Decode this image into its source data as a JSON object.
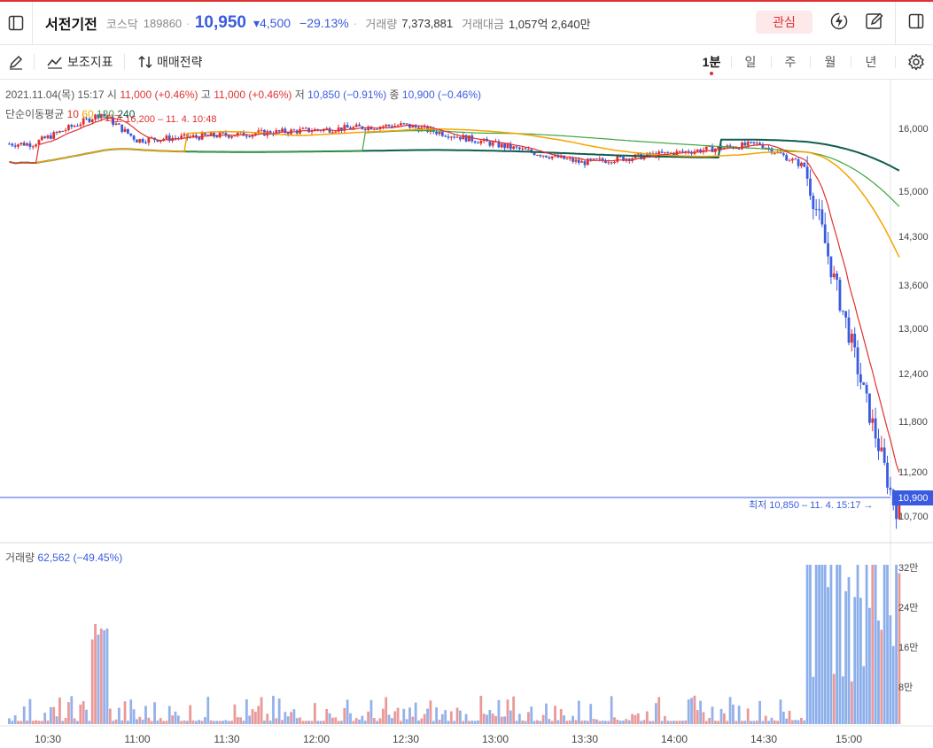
{
  "header": {
    "name": "서전기전",
    "market": "코스닥",
    "code": "189860",
    "price": "10,950",
    "change": "▾4,500",
    "change_pct": "−29.13%",
    "volume_label": "거래량",
    "volume_value": "7,373,881",
    "amount_label": "거래대금",
    "amount_value": "1,057억 2,640만",
    "fav_label": "관심"
  },
  "toolbar": {
    "indicator_label": "보조지표",
    "strategy_label": "매매전략",
    "periods": [
      "1분",
      "일",
      "주",
      "월",
      "년"
    ],
    "active_period": "1분"
  },
  "info": {
    "date": "2021.11.04(목) 15:17",
    "open_label": "시",
    "open": "11,000 (+0.46%)",
    "high_label": "고",
    "high": "11,000 (+0.46%)",
    "low_label": "저",
    "low": "10,850 (−0.91%)",
    "close_label": "종",
    "close": "10,900 (−0.46%)",
    "ma_label": "단순이동평균",
    "ma": [
      "10",
      "60",
      "120",
      "240"
    ],
    "max_note": "최고 16,200 – 11. 4. 10:48",
    "min_note": "최저 10,850 – 11. 4. 15:17 →",
    "volume_label": "거래량",
    "volume_value": "62,562 (−49.45%)"
  },
  "colors": {
    "up": "#e03131",
    "down": "#3a5be0",
    "ma10": "#e03131",
    "ma60": "#f5a300",
    "ma120": "#3da53d",
    "ma240": "#0e5e4e"
  },
  "icons": [
    "panel-icon",
    "flash-icon",
    "edit-icon",
    "panel-icon",
    "pencil-icon",
    "indicator-icon",
    "strategy-icon",
    "gear-icon"
  ],
  "chart_data": {
    "type": "candlestick",
    "current_price": "10,900",
    "price_ticks": [
      "16,000",
      "15,000",
      "14,300",
      "13,600",
      "13,000",
      "12,400",
      "11,800",
      "11,200",
      "10,700"
    ],
    "volume_ticks": [
      "32만",
      "24만",
      "16만",
      "8만"
    ],
    "time_ticks": [
      "10:30",
      "11:00",
      "11:30",
      "12:00",
      "12:30",
      "13:00",
      "13:30",
      "14:00",
      "14:30",
      "15:00"
    ],
    "price_range": [
      10550,
      16650
    ],
    "price_reference": [
      {
        "time": "10:25",
        "price": 15800
      },
      {
        "time": "10:48",
        "price": 16200
      },
      {
        "time": "11:00",
        "price": 15850
      },
      {
        "time": "12:30",
        "price": 16050
      },
      {
        "time": "13:30",
        "price": 15550
      },
      {
        "time": "14:30",
        "price": 15800
      },
      {
        "time": "14:45",
        "price": 15500
      },
      {
        "time": "14:50",
        "price": 14800
      },
      {
        "time": "14:55",
        "price": 14000
      },
      {
        "time": "15:00",
        "price": 13300
      },
      {
        "time": "15:05",
        "price": 12500
      },
      {
        "time": "15:10",
        "price": 11800
      },
      {
        "time": "15:15",
        "price": 11050
      },
      {
        "time": "15:17",
        "price": 10900
      }
    ]
  }
}
